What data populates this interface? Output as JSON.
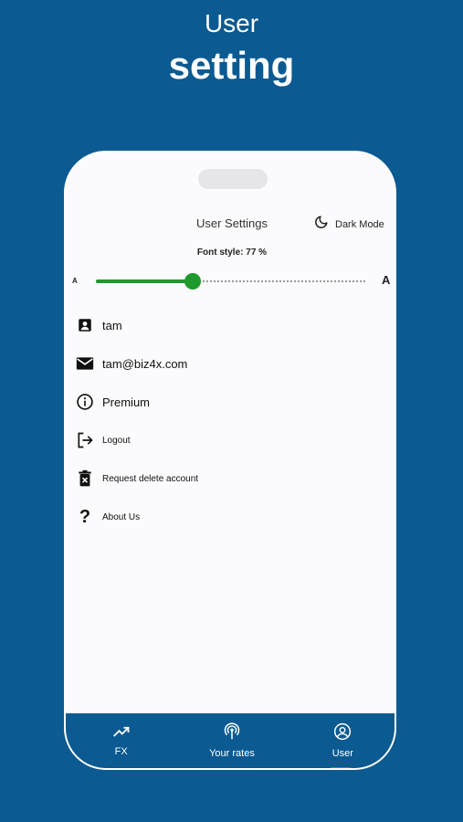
{
  "hero": {
    "line1": "User",
    "line2": "setting"
  },
  "header": {
    "title": "User Settings",
    "dark_mode_label": "Dark Mode"
  },
  "font_slider": {
    "label": "Font style: 77 %",
    "small_glyph": "A",
    "large_glyph": "A",
    "value_fraction": 0.36
  },
  "menu": {
    "items": [
      {
        "label": "tam",
        "icon": "contact-icon"
      },
      {
        "label": "tam@biz4x.com",
        "icon": "mail-icon"
      },
      {
        "label": "Premium",
        "icon": "info-icon"
      },
      {
        "label": "Logout",
        "icon": "logout-icon"
      },
      {
        "label": "Request delete account",
        "icon": "trash-icon"
      },
      {
        "label": "About Us",
        "icon": "question-icon"
      }
    ]
  },
  "bottom_nav": {
    "tabs": [
      {
        "label": "FX",
        "icon": "trending-up-icon"
      },
      {
        "label": "Your rates",
        "icon": "broadcast-icon"
      },
      {
        "label": "User",
        "icon": "user-circle-icon"
      }
    ],
    "active": "User"
  },
  "colors": {
    "background": "#0b5a91",
    "accent": "#1e9a2c",
    "screen": "#fbfbfd"
  }
}
